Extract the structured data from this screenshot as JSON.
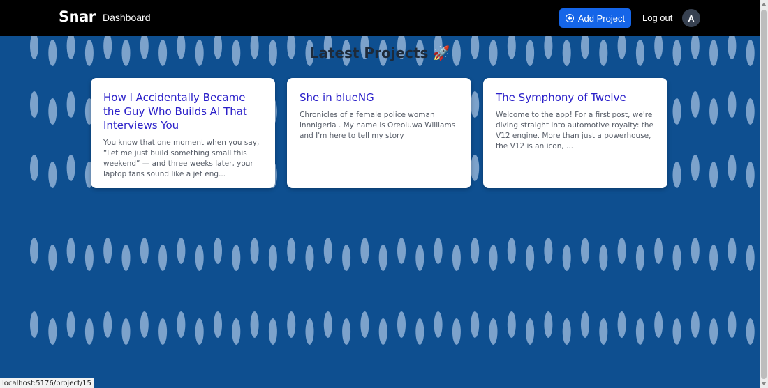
{
  "navbar": {
    "brand": "Snar",
    "dashboard_label": "Dashboard",
    "add_project_label": "Add Project",
    "logout_label": "Log out",
    "avatar_initial": "A"
  },
  "main": {
    "title": "Latest Projects",
    "title_emoji": "🚀",
    "projects": [
      {
        "title": "How I Accidentally Became the Guy Who Builds AI That Interviews You",
        "excerpt": "You know that one moment when you say, “Let me just build something small this weekend” — and three weeks later, your laptop fans sound like a jet eng..."
      },
      {
        "title": "She in blueNG",
        "excerpt": "Chronicles of a female police woman innnigeria . My name is Oreoluwa Williams and I'm here to tell my story"
      },
      {
        "title": "The Symphony of Twelve",
        "excerpt": "Welcome to the app! For a first post, we're diving straight into automotive royalty: the V12 engine. More than just a powerhouse, the V12 is an icon, ..."
      }
    ]
  },
  "status_bar": {
    "url": "localhost:5176/project/15"
  },
  "colors": {
    "background": "#0e4f90",
    "pattern_leaf": "#8fb0d6",
    "navbar": "#000000",
    "primary_button": "#1565e8",
    "card_title": "#2b20c9"
  },
  "icons": {
    "add_project": "plus-circle-icon",
    "title_emoji": "rocket-icon"
  }
}
